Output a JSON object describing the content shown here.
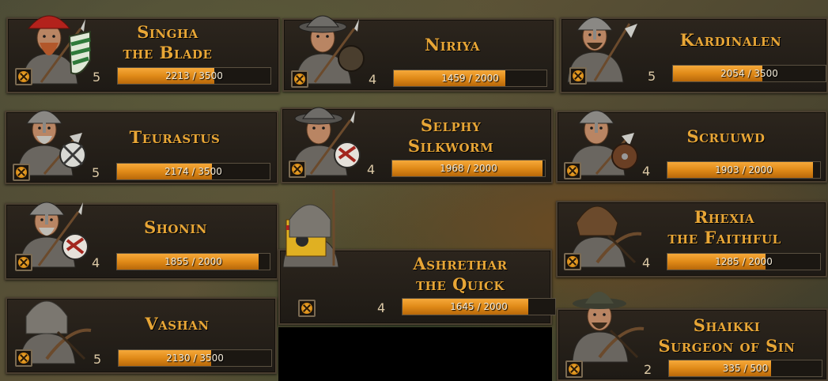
{
  "party": [
    {
      "id": "singha",
      "name_lines": [
        "Singha",
        "the Blade"
      ],
      "level": "5",
      "xp_text": "2213 / 3500",
      "xp": 2213,
      "xp_max": 3500,
      "helmet": "red-cap",
      "shield": "green-striped",
      "weapon": "spear"
    },
    {
      "id": "niriya",
      "name_lines": [
        "Niriya"
      ],
      "level": "4",
      "xp_text": "1459 / 2000",
      "xp": 1459,
      "xp_max": 2000,
      "helmet": "kettle",
      "shield": "round-dark",
      "weapon": "spear"
    },
    {
      "id": "kardinalen",
      "name_lines": [
        "Kardinalen"
      ],
      "level": "5",
      "xp_text": "2054 / 3500",
      "xp": 2054,
      "xp_max": 3500,
      "helmet": "nasal",
      "shield": "none",
      "weapon": "halberd"
    },
    {
      "id": "teurastus",
      "name_lines": [
        "Teurastus"
      ],
      "level": "5",
      "xp_text": "2174 / 3500",
      "xp": 2174,
      "xp_max": 3500,
      "helmet": "nasal",
      "shield": "white-cross",
      "weapon": "axe"
    },
    {
      "id": "selphy",
      "name_lines": [
        "Selphy",
        "Silkworm"
      ],
      "level": "4",
      "xp_text": "1968 / 2000",
      "xp": 1968,
      "xp_max": 2000,
      "helmet": "kettle",
      "shield": "red-white",
      "weapon": "spear"
    },
    {
      "id": "scruuwd",
      "name_lines": [
        "Scruuwd"
      ],
      "level": "4",
      "xp_text": "1903 / 2000",
      "xp": 1903,
      "xp_max": 2000,
      "helmet": "nasal",
      "shield": "wooden",
      "weapon": "axe"
    },
    {
      "id": "shonin",
      "name_lines": [
        "Shonin"
      ],
      "level": "4",
      "xp_text": "1855 / 2000",
      "xp": 1855,
      "xp_max": 2000,
      "helmet": "nasal",
      "shield": "red-white",
      "weapon": "spear"
    },
    {
      "id": "ashrethar",
      "name_lines": [
        "Ashrethar",
        "the Quick"
      ],
      "level": "4",
      "xp_text": "1645 / 2000",
      "xp": 1645,
      "xp_max": 2000,
      "helmet": "mail-coif",
      "shield": "banner",
      "weapon": "banner"
    },
    {
      "id": "rhexia",
      "name_lines": [
        "Rhexia",
        "the Faithful"
      ],
      "level": "4",
      "xp_text": "1285 / 2000",
      "xp": 1285,
      "xp_max": 2000,
      "helmet": "hood",
      "shield": "none",
      "weapon": "crossbow"
    },
    {
      "id": "vashan",
      "name_lines": [
        "Vashan"
      ],
      "level": "5",
      "xp_text": "2130 / 3500",
      "xp": 2130,
      "xp_max": 3500,
      "helmet": "mail-coif",
      "shield": "none",
      "weapon": "crossbow"
    },
    {
      "id": "shaikki",
      "name_lines": [
        "Shaikki",
        "Surgeon of Sin"
      ],
      "level": "2",
      "xp_text": "335 / 500",
      "xp": 335,
      "xp_max": 500,
      "helmet": "wide-hat",
      "shield": "none",
      "weapon": "crossbow"
    }
  ],
  "colors": {
    "name_gold": "#e8a636",
    "xp_fill": "#e08a18",
    "badge_disc": "#f2b23c"
  },
  "icons": {
    "badge": "crossed-swords-disc-icon"
  }
}
